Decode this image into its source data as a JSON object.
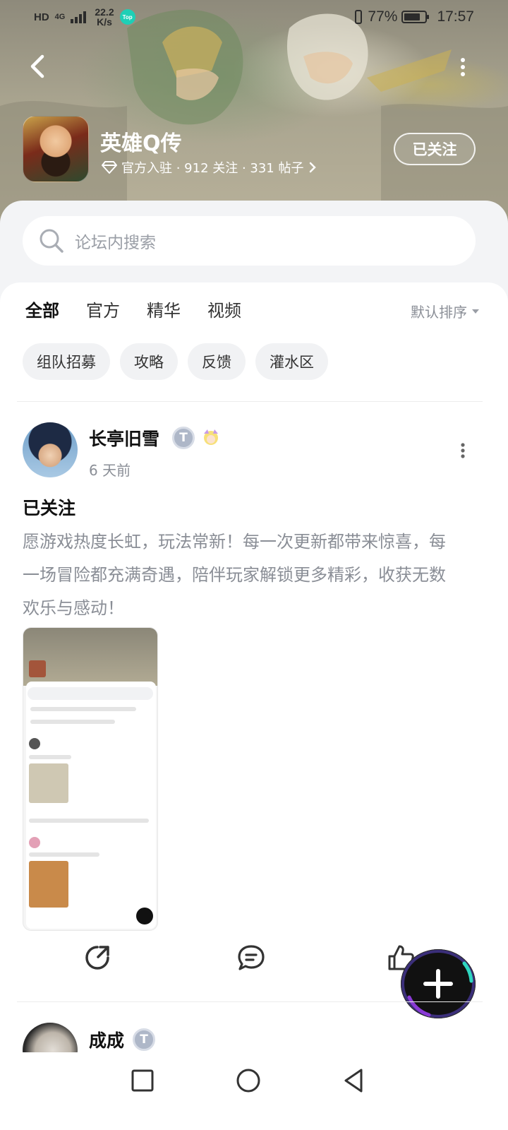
{
  "status_bar": {
    "network_label": "HD",
    "signal_label": "4G",
    "speed_value": "22.2",
    "speed_unit": "K/s",
    "badge_text": "Top",
    "battery_text": "77%",
    "time": "17:57"
  },
  "forum": {
    "name": "英雄Q传",
    "meta": "官方入驻 · 912 关注 · 331 帖子",
    "follow_label": "已关注"
  },
  "search": {
    "placeholder": "论坛内搜索"
  },
  "tabs": [
    {
      "label": "全部",
      "active": true
    },
    {
      "label": "官方",
      "active": false
    },
    {
      "label": "精华",
      "active": false
    },
    {
      "label": "视频",
      "active": false
    }
  ],
  "sort_label": "默认排序",
  "chips": [
    "组队招募",
    "攻略",
    "反馈",
    "灌水区"
  ],
  "post": {
    "author": "长亭旧雪",
    "badge": "T",
    "time": "6 天前",
    "title": "已关注",
    "body": "愿游戏热度长虹，玩法常新！每一次更新都带来惊喜，每一场冒险都充满奇遇，陪伴玩家解锁更多精彩，收获无数欢乐与感动！"
  },
  "post2": {
    "author": "成成",
    "badge": "T"
  },
  "icons": {
    "back": "back-arrow-icon",
    "more": "more-vertical-icon",
    "search": "search-icon",
    "share": "share-icon",
    "comment": "comment-icon",
    "like": "thumbs-up-icon",
    "fab": "plus-icon"
  },
  "colors": {
    "accent": "#2fd6c0",
    "muted_text": "#8a8e96"
  }
}
